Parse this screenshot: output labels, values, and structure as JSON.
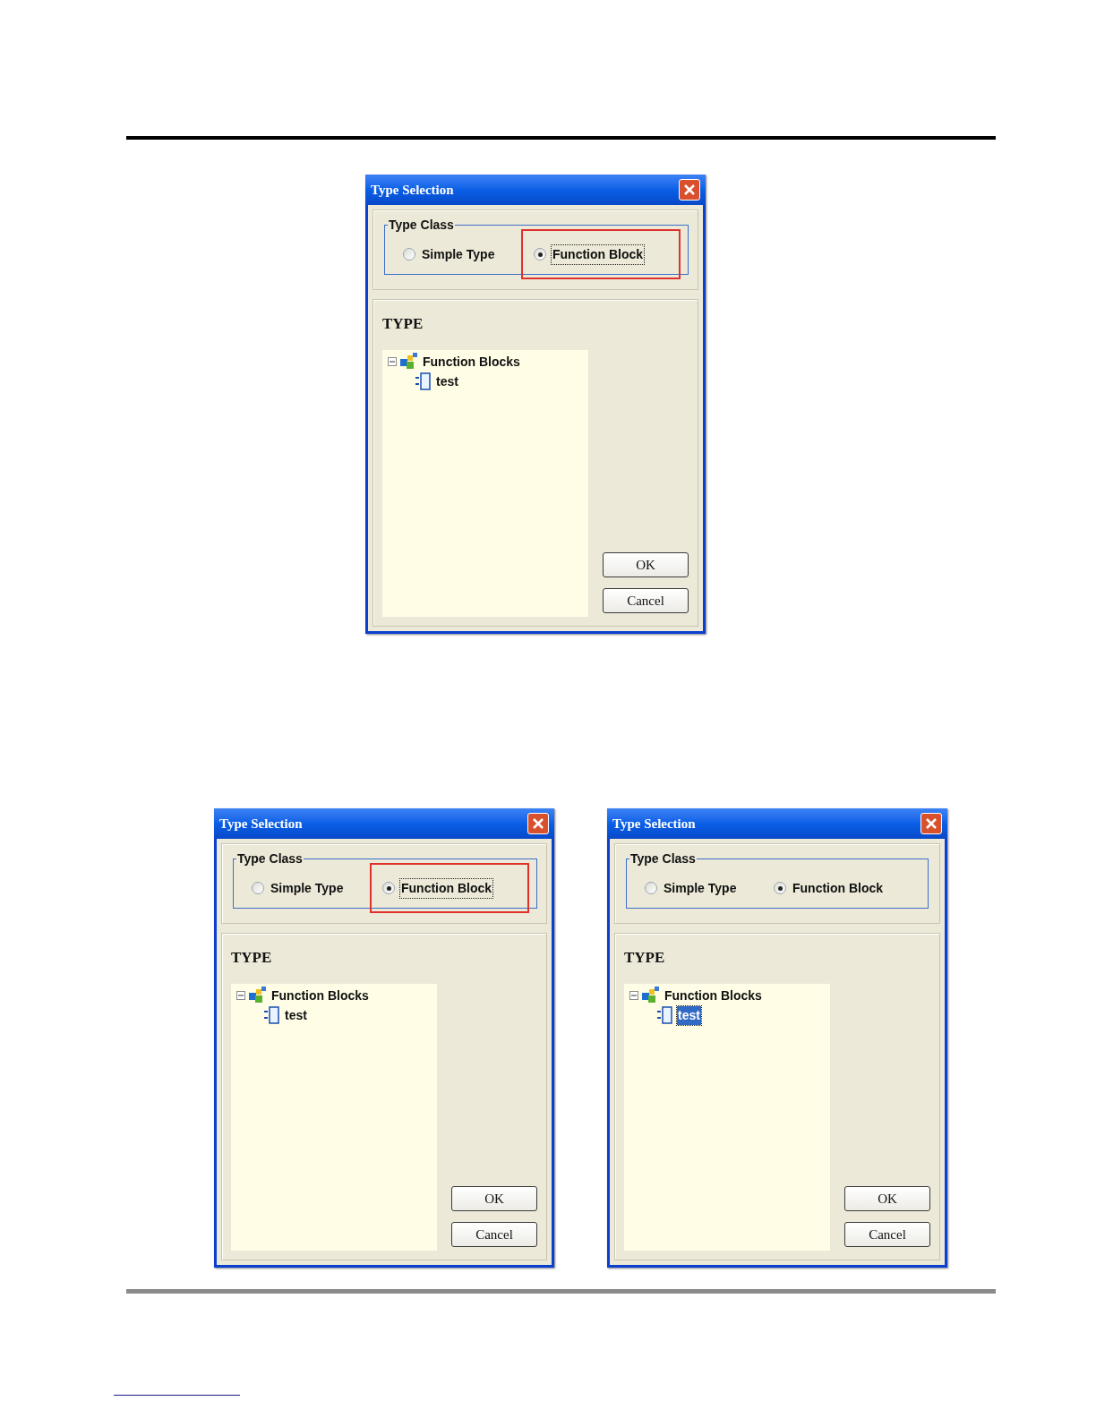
{
  "dialogs": [
    {
      "title": "Type Selection",
      "group_label": "Type Class",
      "highlighted": true,
      "options": [
        {
          "label": "Simple Type",
          "selected": false,
          "focused": false
        },
        {
          "label": "Function Block",
          "selected": true,
          "focused": true
        }
      ],
      "type_label": "TYPE",
      "tree": [
        {
          "label": "Function Blocks",
          "expanded": true,
          "children": [
            {
              "label": "test",
              "selected": false
            }
          ]
        }
      ],
      "buttons": [
        "OK",
        "Cancel"
      ]
    },
    {
      "title": "Type Selection",
      "group_label": "Type Class",
      "highlighted": true,
      "options": [
        {
          "label": "Simple Type",
          "selected": false,
          "focused": false
        },
        {
          "label": "Function Block",
          "selected": true,
          "focused": true
        }
      ],
      "type_label": "TYPE",
      "tree": [
        {
          "label": "Function Blocks",
          "expanded": true,
          "children": [
            {
              "label": "test",
              "selected": false
            }
          ]
        }
      ],
      "buttons": [
        "OK",
        "Cancel"
      ]
    },
    {
      "title": "Type Selection",
      "group_label": "Type Class",
      "highlighted": false,
      "options": [
        {
          "label": "Simple Type",
          "selected": false,
          "focused": false
        },
        {
          "label": "Function Block",
          "selected": true,
          "focused": false
        }
      ],
      "type_label": "TYPE",
      "tree": [
        {
          "label": "Function Blocks",
          "expanded": true,
          "children": [
            {
              "label": "test",
              "selected": true
            }
          ]
        }
      ],
      "buttons": [
        "OK",
        "Cancel"
      ]
    }
  ]
}
